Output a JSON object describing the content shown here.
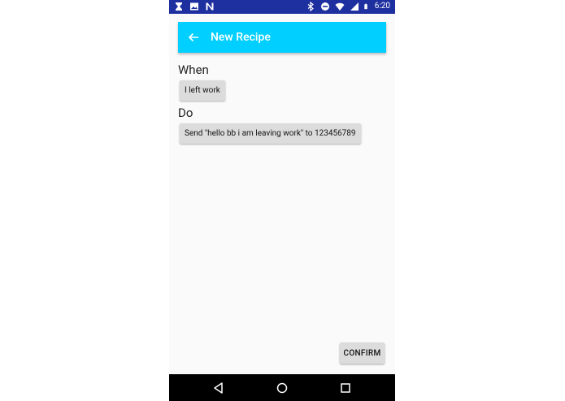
{
  "status_bar": {
    "time": "6:20",
    "icons_left": [
      "hourglass-icon",
      "image-icon",
      "n-logo-icon"
    ],
    "icons_right": [
      "bluetooth-icon",
      "dnd-icon",
      "wifi-icon",
      "signal-icon",
      "battery-icon"
    ]
  },
  "app_bar": {
    "title": "New Recipe",
    "color": "#00cfff"
  },
  "when": {
    "label": "When",
    "trigger": "I left work"
  },
  "do": {
    "label": "Do",
    "action": "Send \"hello bb i am leaving work\" to 123456789"
  },
  "confirm_label": "CONFIRM",
  "colors": {
    "status_bar": "#1e2fa0",
    "background": "#fafafa",
    "chip": "#dcdcdc"
  }
}
